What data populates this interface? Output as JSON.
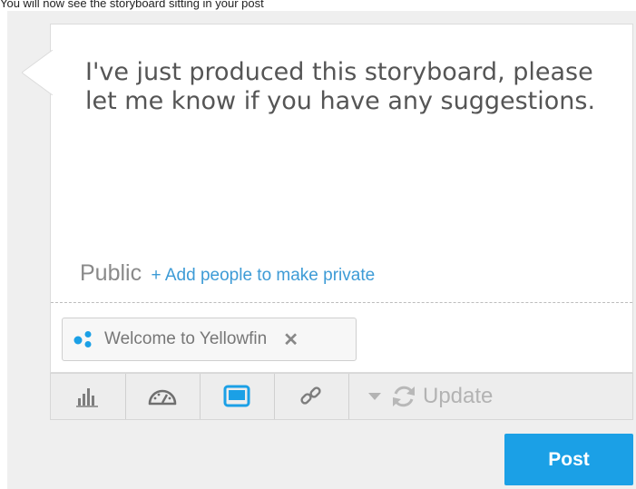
{
  "caption": "You will now see the storyboard sitting in your post",
  "post": {
    "message": "I've just produced this storyboard, please let me know if you have any suggestions.",
    "visibility_label": "Public",
    "add_people_link": "+ Add people to make private"
  },
  "attachment": {
    "icon": "storyboard-dots-icon",
    "label": "Welcome to Yellowfin",
    "remove_icon": "close-icon"
  },
  "toolbar": {
    "buttons": [
      {
        "icon": "report-chart-icon",
        "active": false
      },
      {
        "icon": "dashboard-gauge-icon",
        "active": false
      },
      {
        "icon": "storyboard-icon",
        "active": true
      },
      {
        "icon": "link-icon",
        "active": false
      }
    ],
    "update_label": "Update"
  },
  "actions": {
    "post_label": "Post"
  },
  "colors": {
    "accent": "#1ba0e6",
    "link": "#3d9bd6",
    "icon_gray": "#7d7d7d",
    "background": "#efefef"
  }
}
